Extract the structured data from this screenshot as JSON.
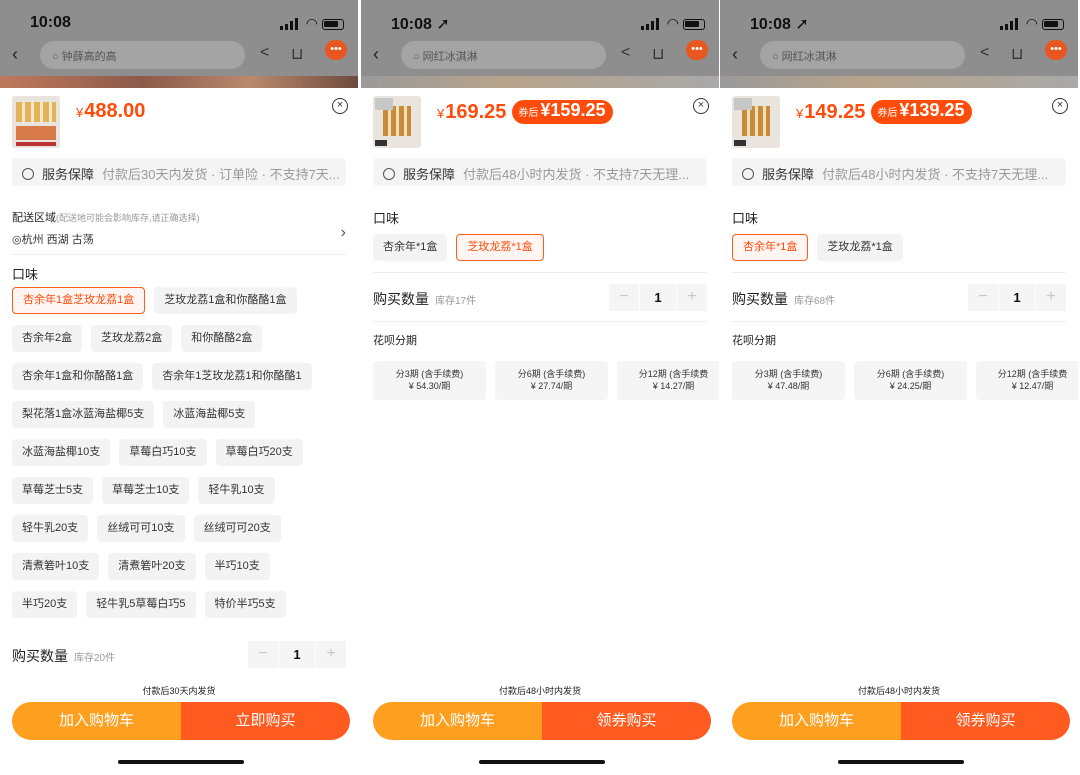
{
  "panels": [
    {
      "status": {
        "time": "10:08",
        "location_arrow": ""
      },
      "nav": {
        "search": "钟薛高的高"
      },
      "product": {
        "currency": "¥",
        "price": "488.00",
        "coupon_label": "",
        "coupon_price": ""
      },
      "service": {
        "label": "服务保障",
        "detail": "付款后30天内发货 · 订单险 · 不支持7天..."
      },
      "delivery": {
        "title": "配送区域",
        "note": "(配送地可能会影响库存,请正确选择)",
        "location": "杭州 西湖 古荡"
      },
      "flavor_title": "口味",
      "options": [
        {
          "label": "杏余年1盒芝玫龙荔1盒",
          "selected": true
        },
        {
          "label": "芝玫龙荔1盒和你酪酪1盒",
          "selected": false
        },
        {
          "label": "杏余年2盒",
          "selected": false
        },
        {
          "label": "芝玫龙荔2盒",
          "selected": false
        },
        {
          "label": "和你酪酪2盒",
          "selected": false
        },
        {
          "label": "杏余年1盒和你酪酪1盒",
          "selected": false
        },
        {
          "label": "杏余年1芝玫龙荔1和你酪酪1",
          "selected": false
        },
        {
          "label": "梨花落1盒冰蓝海盐椰5支",
          "selected": false
        },
        {
          "label": "冰蓝海盐椰5支",
          "selected": false
        },
        {
          "label": "冰蓝海盐椰10支",
          "selected": false
        },
        {
          "label": "草莓白巧10支",
          "selected": false
        },
        {
          "label": "草莓白巧20支",
          "selected": false
        },
        {
          "label": "草莓芝士5支",
          "selected": false
        },
        {
          "label": "草莓芝士10支",
          "selected": false
        },
        {
          "label": "轻牛乳10支",
          "selected": false
        },
        {
          "label": "轻牛乳20支",
          "selected": false
        },
        {
          "label": "丝绒可可10支",
          "selected": false
        },
        {
          "label": "丝绒可可20支",
          "selected": false
        },
        {
          "label": "清煮箬叶10支",
          "selected": false
        },
        {
          "label": "清煮箬叶20支",
          "selected": false
        },
        {
          "label": "半巧10支",
          "selected": false
        },
        {
          "label": "半巧20支",
          "selected": false
        },
        {
          "label": "轻牛乳5草莓白巧5",
          "selected": false
        },
        {
          "label": "特价半巧5支",
          "selected": false
        }
      ],
      "quantity": {
        "label": "购买数量",
        "stock": "库存20件",
        "value": "1",
        "minus": "−",
        "plus": "+"
      },
      "installment_title": "",
      "installments": [],
      "ship_note": "付款后30天内发货",
      "buttons": {
        "add": "加入购物车",
        "buy": "立即购买"
      }
    },
    {
      "status": {
        "time": "10:08",
        "location_arrow": "➚"
      },
      "nav": {
        "search": "网红冰淇淋"
      },
      "product": {
        "currency": "¥",
        "price": "169.25",
        "coupon_label": "券后",
        "coupon_price": "¥159.25"
      },
      "service": {
        "label": "服务保障",
        "detail": "付款后48小时内发货 · 不支持7天无理..."
      },
      "flavor_title": "口味",
      "options": [
        {
          "label": "杏余年*1盒",
          "selected": false
        },
        {
          "label": "芝玫龙荔*1盒",
          "selected": true
        }
      ],
      "quantity": {
        "label": "购买数量",
        "stock": "库存17件",
        "value": "1",
        "minus": "−",
        "plus": "+"
      },
      "installment_title": "花呗分期",
      "installments": [
        {
          "plan": "分3期 (含手续费)",
          "amount": "¥ 54.30/期"
        },
        {
          "plan": "分6期 (含手续费)",
          "amount": "¥ 27.74/期"
        },
        {
          "plan": "分12期 (含手续费",
          "amount": "¥ 14.27/期"
        }
      ],
      "ship_note": "付款后48小时内发货",
      "buttons": {
        "add": "加入购物车",
        "buy": "领券购买"
      }
    },
    {
      "status": {
        "time": "10:08",
        "location_arrow": "➚"
      },
      "nav": {
        "search": "网红冰淇淋"
      },
      "product": {
        "currency": "¥",
        "price": "149.25",
        "coupon_label": "券后",
        "coupon_price": "¥139.25"
      },
      "service": {
        "label": "服务保障",
        "detail": "付款后48小时内发货 · 不支持7天无理..."
      },
      "flavor_title": "口味",
      "options": [
        {
          "label": "杏余年*1盒",
          "selected": true
        },
        {
          "label": "芝玫龙荔*1盒",
          "selected": false
        }
      ],
      "quantity": {
        "label": "购买数量",
        "stock": "库存68件",
        "value": "1",
        "minus": "−",
        "plus": "+"
      },
      "installment_title": "花呗分期",
      "installments": [
        {
          "plan": "分3期 (含手续费)",
          "amount": "¥ 47.48/期"
        },
        {
          "plan": "分6期 (含手续费)",
          "amount": "¥ 24.25/期"
        },
        {
          "plan": "分12期 (含手续费",
          "amount": "¥ 12.47/期"
        }
      ],
      "ship_note": "付款后48小时内发货",
      "buttons": {
        "add": "加入购物车",
        "buy": "领券购买"
      }
    }
  ],
  "colors": {
    "accent": "#ff4c0a",
    "add_button": "#ff9f20",
    "buy_button": "#ff5a1f"
  },
  "icons": {
    "back": "chevron-left-icon",
    "share": "share-icon",
    "cart": "cart-icon",
    "close": "close-circle-icon",
    "service": "shield-badge-icon",
    "location": "location-pin-icon"
  }
}
